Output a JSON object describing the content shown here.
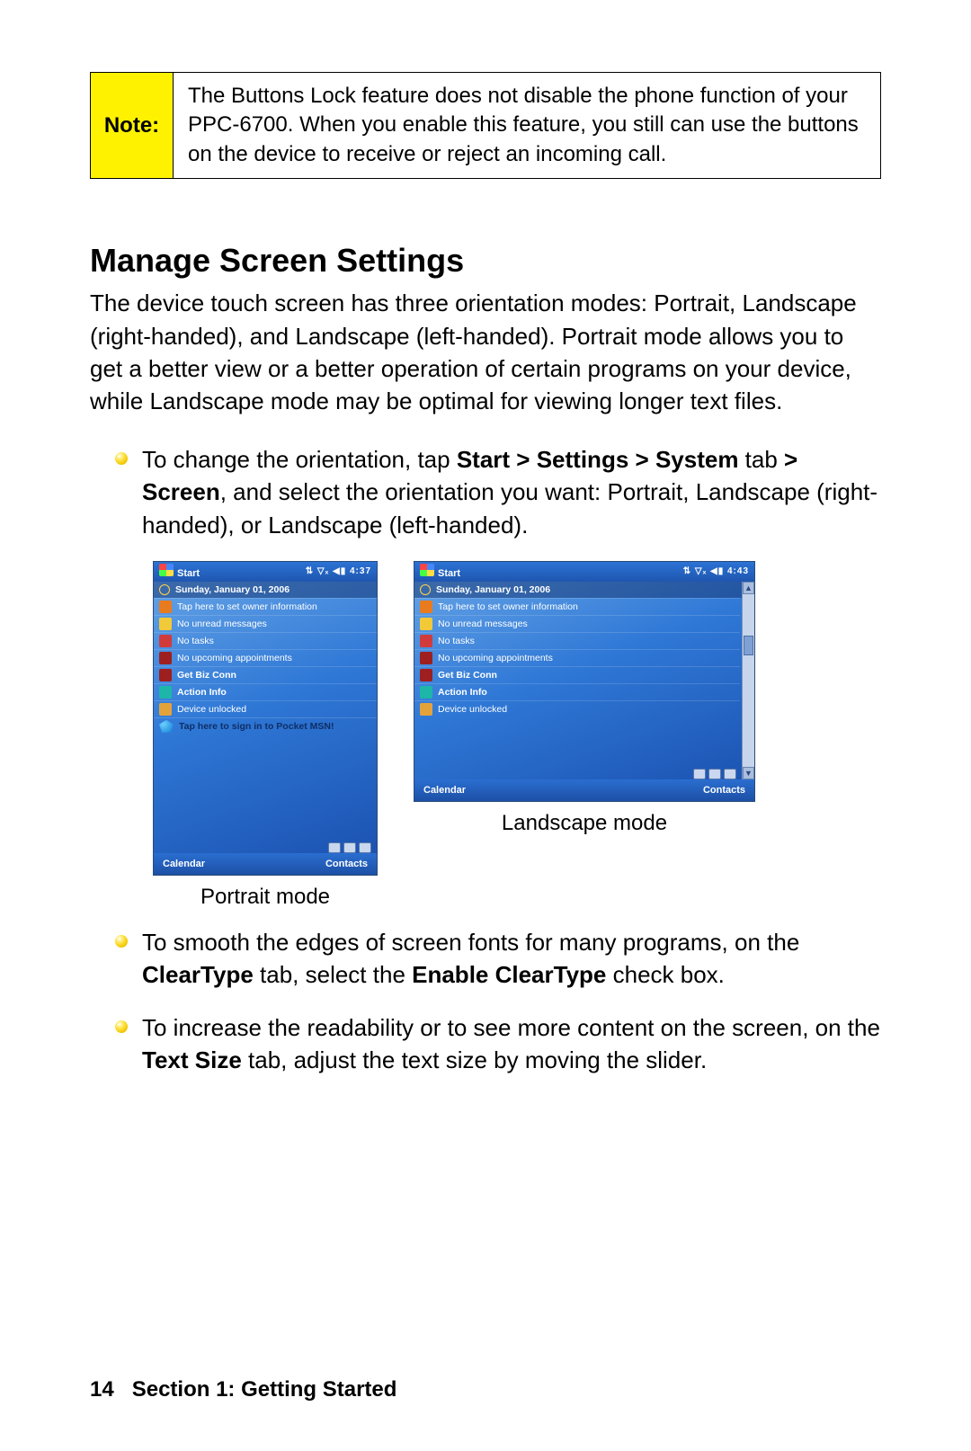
{
  "note": {
    "label": "Note:",
    "text": "The Buttons Lock feature does not disable the phone function of your PPC-6700. When you enable this feature, you still can use the buttons on the device to receive or reject an incoming call."
  },
  "heading": "Manage Screen Settings",
  "intro": "The device touch screen has three orientation modes: Portrait, Landscape (right-handed), and Landscape (left-handed). Portrait mode allows you to get a better view or a better operation of certain programs on your device, while Landscape mode may be optimal for viewing longer text files.",
  "bullets": {
    "b1_pre": "To change the orientation, tap ",
    "b1_bold1": "Start",
    "b1_gt1": ">",
    "b1_bold2": "Settings",
    "b1_gt2": ">",
    "b1_bold3": "System",
    "b1_mid1": " tab ",
    "b1_gt3": ">",
    "b1_bold4": "Screen",
    "b1_post": ", and select the orientation you want: Portrait, Landscape (right-handed), or Landscape (left-handed).",
    "b2_pre": "To smooth the edges of screen fonts for many programs, on the ",
    "b2_bold1": "ClearType",
    "b2_mid": " tab, select the ",
    "b2_bold2": "Enable ClearType",
    "b2_post": " check box.",
    "b3_pre": "To increase the readability or to see more content on the screen, on the ",
    "b3_bold1": "Text Size",
    "b3_post": " tab, adjust the text size by moving the slider."
  },
  "captions": {
    "portrait": "Portrait mode",
    "landscape": "Landscape mode"
  },
  "device": {
    "title": "Start",
    "time_portrait": "4:37",
    "time_landscape": "4:43",
    "date": "Sunday, January 01, 2006",
    "rows": {
      "owner": "Tap here to set owner information",
      "messages": "No unread messages",
      "tasks": "No tasks",
      "appts": "No upcoming appointments",
      "biz": "Get Biz Conn",
      "action": "Action Info",
      "unlocked": "Device unlocked",
      "msn": "Tap here to sign in to Pocket MSN!"
    },
    "soft_left": "Calendar",
    "soft_right": "Contacts"
  },
  "footer": {
    "page_num": "14",
    "section": "Section 1: Getting Started"
  }
}
